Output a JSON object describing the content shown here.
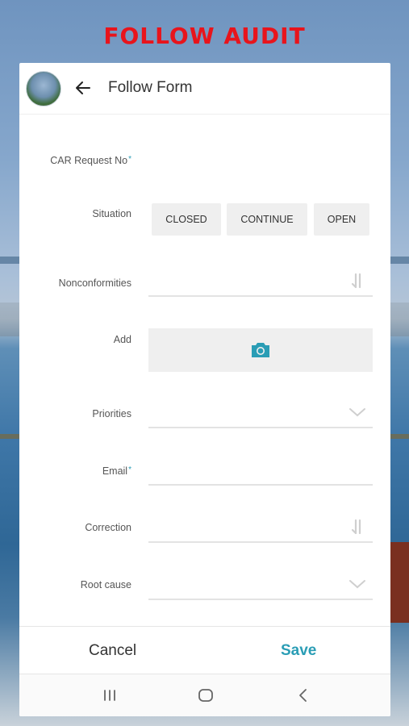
{
  "banner": {
    "title": "FOLLOW AUDIT"
  },
  "header": {
    "title": "Follow Form",
    "back_icon": "arrow-left-icon",
    "avatar_icon": "seaside-avatar"
  },
  "form": {
    "car_request": {
      "label": "CAR Request No",
      "required_mark": "*"
    },
    "situation": {
      "label": "Situation",
      "options": [
        "CLOSED",
        "CONTINUE",
        "OPEN"
      ]
    },
    "nonconformities": {
      "label": "Nonconformities",
      "icon": "sort-down-icon"
    },
    "add": {
      "label": "Add",
      "icon": "camera-icon"
    },
    "priorities": {
      "label": "Priorities",
      "icon": "chevron-down-icon"
    },
    "email": {
      "label": "Email",
      "required_mark": "*"
    },
    "correction": {
      "label": "Correction",
      "icon": "sort-down-icon"
    },
    "root_cause": {
      "label": "Root cause",
      "icon": "chevron-down-icon"
    }
  },
  "footer": {
    "cancel_label": "Cancel",
    "save_label": "Save"
  },
  "navbar": {
    "recent_icon": "recent-apps-icon",
    "home_icon": "home-icon",
    "back_icon": "back-nav-icon"
  },
  "colors": {
    "accent": "#2a9db5",
    "banner": "#e8141c",
    "segment_bg": "#efefef"
  }
}
